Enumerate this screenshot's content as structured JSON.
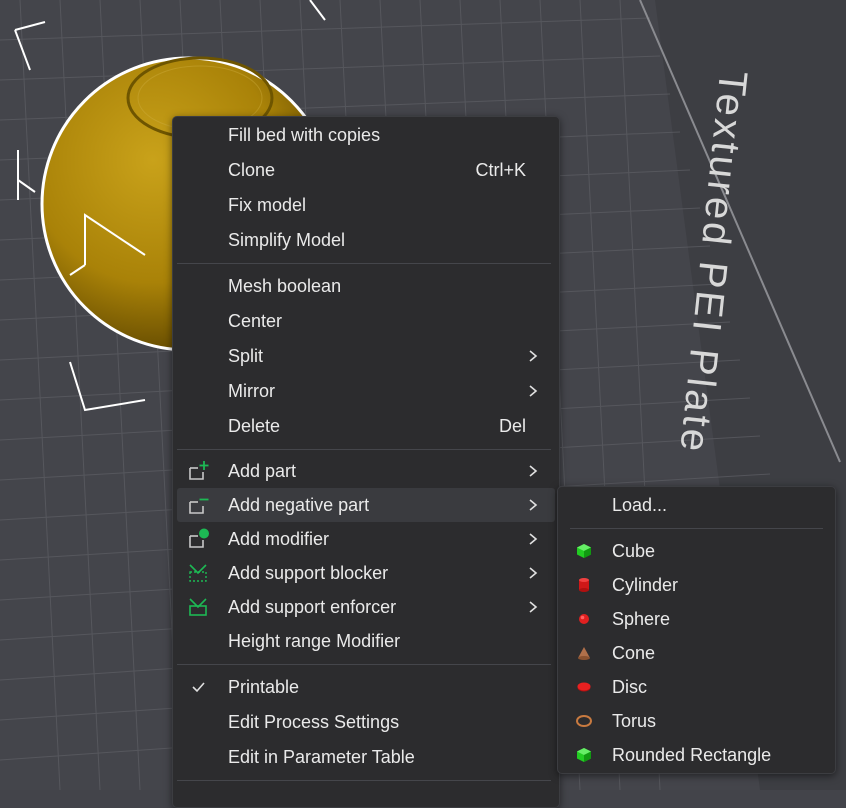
{
  "viewport": {
    "bed_text": "Textured PEI Plate",
    "object_color": "#b08a10"
  },
  "context_menu": {
    "items": [
      {
        "label": "Fill bed with copies"
      },
      {
        "label": "Clone",
        "shortcut": "Ctrl+K"
      },
      {
        "label": "Fix model"
      },
      {
        "label": "Simplify Model"
      },
      {
        "label": "Mesh boolean"
      },
      {
        "label": "Center"
      },
      {
        "label": "Split"
      },
      {
        "label": "Mirror"
      },
      {
        "label": "Delete",
        "shortcut": "Del"
      },
      {
        "label": "Add part",
        "icon": "add-part-icon"
      },
      {
        "label": "Add negative part",
        "icon": "add-negative-part-icon"
      },
      {
        "label": "Add modifier",
        "icon": "add-modifier-icon"
      },
      {
        "label": "Add support blocker",
        "icon": "support-blocker-icon"
      },
      {
        "label": "Add support enforcer",
        "icon": "support-enforcer-icon"
      },
      {
        "label": "Height range Modifier"
      },
      {
        "label": "Printable",
        "checked": true,
        "icon": "checkmark-icon"
      },
      {
        "label": "Edit Process Settings"
      },
      {
        "label": "Edit in Parameter Table"
      }
    ]
  },
  "submenu": {
    "items": [
      {
        "label": "Load..."
      },
      {
        "label": "Cube",
        "icon": "cube-icon"
      },
      {
        "label": "Cylinder",
        "icon": "cylinder-icon"
      },
      {
        "label": "Sphere",
        "icon": "sphere-icon"
      },
      {
        "label": "Cone",
        "icon": "cone-icon"
      },
      {
        "label": "Disc",
        "icon": "disc-icon"
      },
      {
        "label": "Torus",
        "icon": "torus-icon"
      },
      {
        "label": "Rounded Rectangle",
        "icon": "rounded-rectangle-icon"
      }
    ]
  },
  "colors": {
    "menu_bg": "#2c2c2e",
    "accent_green": "#1db954",
    "primitive_red": "#e02020",
    "primitive_green": "#22cc22",
    "cone_brown": "#b0704a",
    "torus_orange": "#c87a40"
  }
}
